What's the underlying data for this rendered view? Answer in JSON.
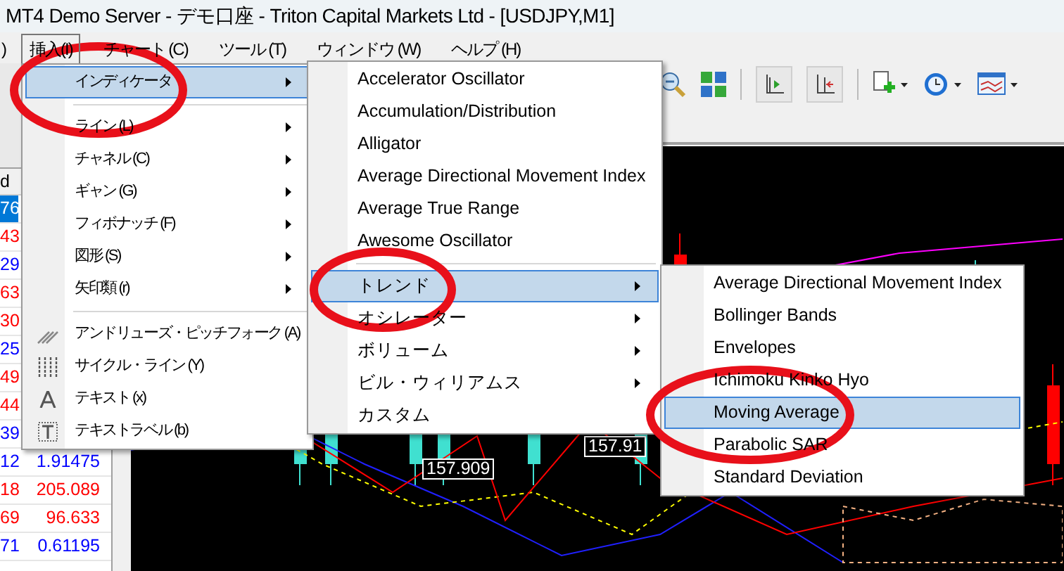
{
  "window": {
    "title": "MT4 Demo Server - デモ口座 - Triton Capital Markets Ltd - [USDJPY,M1]"
  },
  "menu_bar": [
    {
      "label": ")",
      "selected": false
    },
    {
      "label": "挿入(I)",
      "selected": true
    },
    {
      "label": "チャート (C)",
      "selected": false
    },
    {
      "label": "ツール (T)",
      "selected": false
    },
    {
      "label": "ウィンドウ (W)",
      "selected": false
    },
    {
      "label": "ヘルプ (H)",
      "selected": false
    }
  ],
  "market_watch": {
    "header": "d",
    "rows": [
      {
        "column_1": "76",
        "selected": true
      },
      {
        "column_1": "43",
        "selected": false,
        "color": "#ff0000"
      },
      {
        "column_1": "29",
        "selected": false,
        "color": "#0000ff"
      },
      {
        "column_1": "63",
        "selected": false,
        "color": "#ff0000"
      },
      {
        "column_1": "30",
        "selected": false,
        "color": "#ff0000"
      },
      {
        "column_1": "25",
        "selected": false,
        "color": "#0000ff"
      },
      {
        "column_1": "49",
        "selected": false,
        "color": "#ff0000"
      },
      {
        "column_1": "44",
        "selected": false,
        "color": "#ff0000"
      },
      {
        "column_1": "39",
        "selected": false,
        "color": "#0000ff"
      },
      {
        "column_1": "12",
        "column_2": "1.91475",
        "selected": false,
        "color": "#0000ff"
      },
      {
        "column_1": "18",
        "column_2": "205.089",
        "selected": false,
        "color": "#ff0000"
      },
      {
        "column_1": "69",
        "column_2": "96.633",
        "selected": false,
        "color": "#ff0000"
      },
      {
        "column_1": "71",
        "column_2": "0.61195",
        "selected": false,
        "color": "#0000ff"
      }
    ]
  },
  "insert_menu": [
    {
      "kind": "item",
      "label": "インディケータ",
      "has_submenu": true,
      "selected": true
    },
    {
      "kind": "separator"
    },
    {
      "kind": "item",
      "label": "ライン (L)",
      "has_submenu": true,
      "selected": false
    },
    {
      "kind": "item",
      "label": "チャネル (C)",
      "has_submenu": true,
      "selected": false
    },
    {
      "kind": "item",
      "label": "ギャン (G)",
      "has_submenu": true,
      "selected": false
    },
    {
      "kind": "item",
      "label": "フィボナッチ (F)",
      "has_submenu": true,
      "selected": false
    },
    {
      "kind": "item",
      "label": "図形 (S)",
      "has_submenu": true,
      "selected": false
    },
    {
      "kind": "item",
      "label": "矢印類 (r)",
      "has_submenu": true,
      "selected": false
    },
    {
      "kind": "separator"
    },
    {
      "kind": "tool",
      "label": "アンドリューズ・ピッチフォーク (A)",
      "has_submenu": false,
      "selected": false
    },
    {
      "kind": "tool",
      "label": "サイクル・ライン (Y)",
      "has_submenu": false,
      "selected": false
    },
    {
      "kind": "tool",
      "label": "テキスト (x)",
      "has_submenu": false,
      "selected": false
    },
    {
      "kind": "tool",
      "label": "テキストラベル (b)",
      "has_submenu": false,
      "selected": false
    }
  ],
  "indicators_menu": [
    {
      "kind": "item",
      "label": "Accelerator Oscillator",
      "has_submenu": false,
      "selected": false
    },
    {
      "kind": "item",
      "label": "Accumulation/Distribution",
      "has_submenu": false,
      "selected": false
    },
    {
      "kind": "item",
      "label": "Alligator",
      "has_submenu": false,
      "selected": false
    },
    {
      "kind": "item",
      "label": "Average Directional Movement Index",
      "has_submenu": false,
      "selected": false
    },
    {
      "kind": "item",
      "label": "Average True Range",
      "has_submenu": false,
      "selected": false
    },
    {
      "kind": "item",
      "label": "Awesome Oscillator",
      "has_submenu": false,
      "selected": false
    },
    {
      "kind": "separator"
    },
    {
      "kind": "item",
      "label": "トレンド",
      "has_submenu": true,
      "selected": true
    },
    {
      "kind": "item",
      "label": "オシレーター",
      "has_submenu": true,
      "selected": false
    },
    {
      "kind": "item",
      "label": "ボリューム",
      "has_submenu": true,
      "selected": false
    },
    {
      "kind": "item",
      "label": "ビル・ウィリアムス",
      "has_submenu": true,
      "selected": false
    },
    {
      "kind": "item",
      "label": "カスタム",
      "has_submenu": false,
      "selected": false
    }
  ],
  "trend_menu": [
    {
      "label": "Average Directional Movement Index",
      "has_submenu": false,
      "selected": false
    },
    {
      "label": "Bollinger Bands",
      "has_submenu": false,
      "selected": false
    },
    {
      "label": "Envelopes",
      "has_submenu": false,
      "selected": false
    },
    {
      "label": "Ichimoku Kinko Hyo",
      "has_submenu": false,
      "selected": false
    },
    {
      "label": "Moving Average",
      "has_submenu": false,
      "selected": true
    },
    {
      "label": "Parabolic SAR",
      "has_submenu": false,
      "selected": false
    },
    {
      "label": "Standard Deviation",
      "has_submenu": false,
      "selected": false
    }
  ],
  "chart": {
    "price_labels": [
      "157.909",
      "157.91"
    ]
  }
}
